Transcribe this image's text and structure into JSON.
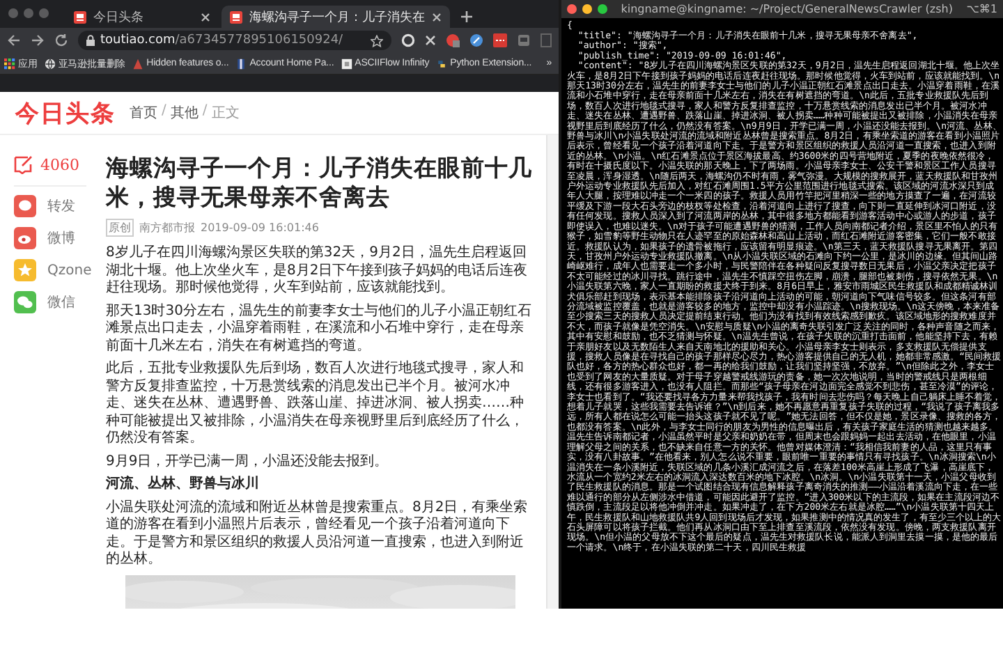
{
  "browser": {
    "tabs": [
      {
        "title": "今日头条",
        "selected": false
      },
      {
        "title": "海螺沟寻子一个月：儿子消失在",
        "selected": true
      }
    ],
    "url_host": "toutiao.com",
    "url_path": "/a6734577895106150924/",
    "bookmarks": [
      "应用",
      "亚马逊批量删除",
      "Hidden features o...",
      "Account Home Pa...",
      "ASCIIFlow Infinity",
      "Python Extension..."
    ],
    "bookmarks_more": "»",
    "page": {
      "logo": "今日头条",
      "breadcrumb": [
        "首页",
        "其他",
        "正文"
      ],
      "breadcrumb_separator": "/",
      "comment_count": "4060",
      "share": [
        {
          "kind": "repost",
          "label": "转发",
          "color": "#ea5a4f"
        },
        {
          "kind": "weibo",
          "label": "微博",
          "color": "#ea5a4f"
        },
        {
          "kind": "qzone",
          "label": "Qzone",
          "color": "#f6bb2e"
        },
        {
          "kind": "wechat",
          "label": "微信",
          "color": "#52bf4f"
        }
      ],
      "article": {
        "title": "海螺沟寻子一个月：儿子消失在眼前十几米，搜寻无果母亲不舍离去",
        "tag": "原创",
        "source": "南方都市报",
        "time": "2019-09-09 16:01:46",
        "blocks": [
          {
            "kind": "paragraph",
            "text": "8岁儿子在四川海螺沟景区失联的第32天，9月2日，温先生启程返回湖北十堰。他上次坐火车，是8月2日下午接到孩子妈妈的电话后连夜赶往现场。那时候他觉得，火车到站前，应该就能找到。"
          },
          {
            "kind": "paragraph",
            "text": "那天13时30分左右，温先生的前妻李女士与他们的儿子小温正朝红石滩景点出口走去，小温穿着雨鞋，在溪流和小石堆中穿行，走在母亲前面十几米左右，消失在有树遮挡的弯道。"
          },
          {
            "kind": "paragraph",
            "text": "此后，五批专业救援队先后到场，数百人次进行地毯式搜寻，家人和警方反复排查监控，十万悬赏线索的消息发出已半个月。被河水冲走、迷失在丛林、遭遇野兽、跌落山崖、掉进冰洞、被人拐卖……种种可能被提出又被排除，小温消失在母亲视野里后到底经历了什么，仍然没有答案。"
          },
          {
            "kind": "paragraph",
            "text": "9月9日，开学已满一周，小温还没能去报到。"
          },
          {
            "kind": "heading",
            "text": "河流、丛林、野兽与冰川"
          },
          {
            "kind": "paragraph",
            "text": "小温失联处河流的流域和附近丛林曾是搜索重点。8月2日，有乘坐索道的游客在看到小温照片后表示，曾经看见一个孩子沿着河道向下走。于是警方和景区组织的救援人员沿河道一直搜索，也进入到附近的丛林。"
          }
        ]
      }
    }
  },
  "terminal": {
    "title": "kingname@kingname: ~/Project/GeneralNewsCrawler (zsh)",
    "shortcut": "⌥⌘1",
    "lines": [
      "{",
      "  \"title\": \"海螺沟寻子一个月：儿子消失在眼前十几米，搜寻无果母亲不舍离去\",",
      "  \"author\": \"搜索\",",
      "  \"publish_time\": \"2019-09-09 16:01:46\",",
      "  \"content\": \"8岁儿子在四川海螺沟景区失联的第32天，9月2日，温先生启程返回湖北十堰。他上次坐火车，是8月2日下午接到孩子妈妈的电话后连夜赶往现场。那时候他觉得，火车到站前，应该就能找到。\\n那天13时30分左右，温先生的前妻李女士与他们的儿子小温正朝红石滩景点出口走去。小温穿着雨鞋，在溪流和小石堆中穿行，走在母亲前面十几米左右，消失在有树遮挡的弯道。\\n此后，五批专业救援队先后到场，数百人次进行地毯式搜寻，家人和警方反复排查监控，十万悬赏线索的消息发出已半个月。被河水冲走、迷失在丛林、遭遇野兽、跌落山崖、掉进冰洞、被人拐卖……种种可能被提出又被排除，小温消失在母亲视野里后到底经历了什么，仍然没有答案。\\n9月9日，开学已满一周，小温还没能去报到。\\n河流、丛林、野兽与冰川\\n小温失联处河流的流域和附近丛林曾是搜索重点。8月2日，有乘坐索道的游客在看到小温照片后表示，曾经看见一个孩子沿着河道向下走。于是警方和景区组织的救援人员沿河道一直搜索，也进入到附近的丛林。\\n小温。\\n红石滩景点位于景区海拔最高、约3600米的四号营地附近，夏季的夜晚依然很冷，有时在十摄氏度以下。小温失联的那天晚上，下了两场雨。小温母亲李女士、公安干警和景区工作人员搜寻至凌晨，浑身湿透。\\n随后两天，海螺沟仍不时有雨，雾气弥漫。大规模的搜救展开，蓝天救援队和甘孜州户外运动专业救援队先后加入，对红石滩周围1.5平方公里范围进行地毯式搜索。该区域的河流水深只到成年人大腿，按理难以冲走一个一米四的孩子。救援人员用竹竿把河里稍深一些的地方摸查了一遍，在河流较平缓及下游一段大石头旁边的枝杈等处检查，沿着河道向上进行了搜查，向下则一直延伸到冰河口附近，没有任何发现。搜救人员深入到了河流两岸的丛林，其中很多地方都能看到游客活动中心或游人的步道，孩子即使误入，也难以迷失。\\n对于孩子可能遭遇野兽的猜测，工作人员向南都记者介绍，景区里不怕人的只有猴子，如雪豹等野生动物只在人迹罕至的原始森林和高山上活动，而红石滩附近游客密集，它们一般不敢接近。救援队认为，如果孩子的遗骨被拖行，应该留有明显痕迹。\\n第三天，蓝天救援队搜寻无果离开。第四天，甘孜州户外运动专业救援队撤离。\\n从小温失联区域的石滩向下约一公里，是冰川的边缘。但其间山路崎岖难行，成年人也需要走一个多小时，与民警陪伴在各种疑问反复搜寻数日无果后，小温父亲决定把孩子不太可能经过的冰川寻找。跳行途中，温先生不慎踩空扭伤左脚，崩溃，腿部也被刺伤，搜寻依然无果。\\n小温失联第六晚，家人一直期盼的救援犬终于到来。8月6日早上，雅安市雨城区民生救援队和成都精诚林训犬俱乐部赶到现场，表示基本能排除孩子沿河道向上活动的可能，朝河道向下气味信号较多。但这条河有部分流域被监控覆盖，也就是游客较多的地方，监控中却没有小温踪迹。\\n搜救现场。\\n这天傍晚，本来准备至少搜索三天的搜救人员决定提前结束行动。他们为没有找到有效线索感到歉疚。该区域地形的搜救难度并不大，而孩子就像是凭空消失。\\n安慰与质疑\\n小温的离奇失联引发广泛关注的同时，各种声音随之而来，其中有安慰和鼓励，也不乏猜测与怀疑。\\n温先生曾说，在孩子失联的沉重打击面前，他能坚持下去，有赖于亲朋好友以及无数陌生人来自天南地北的援助和关心。小温母亲李女士则表示，多支救援队无偿提供支援，搜救人员像是在寻找自己的孩子那样尽心尽力，热心游客提供自己的无人机，她都非常感激。“民间救援队也好，各方的热心群众也好，都一再的给我们鼓励，让我们坚持坚强，不放弃。”\\n但除此之外，李女士也受到了网友的大量质疑。对于母子穿越警戒线游玩的责备，她一次次地说明，当时的警戒线只是两根细线，还有很多游客进入，也没有人阻拦。而那些“孩子母亲在河边面完全感觉不到悲伤，甚至冷漠”的评论，李女士也看到了。“我还要找寻各方力量来帮我找孩子，我有时间去悲伤吗？每天晚上自己躺床上睡不着觉，想着儿子就哭，这些我需要去告诉谁？”\\n到后来，她不再愿意再重复孩子失联的过程，“我说了孩子离我多远，所有人都在说怎么可能一抬头这孩子就不见了呢。”她无法回答，但不仅是她，景区录像、搜救的各方，也都没有答案。\\n此外，与李女士同行的朋友为男性的信息曝出后，有关孩子家庭生活的猜测也越来越多。温先生告诉南都记者，小温虽然平时是父亲和奶奶在带，但周末也会跟妈妈一起出去活动，在他眼里，小温理解父母之间的关系，也不缺来自任意一方的关怀。他曾对媒体澄清：“我相信我前妻的人品，这里只有事实，没有八卦故事。”在他看来，别人怎么说不重要，眼前唯一重要的事情只有寻找孩子。\\n冰洞搜索\\n小温消失在一条小溪附近，失联区域的几条小溪汇成河流之后，在落差100米高崖上形成了飞瀑，高崖底下，水流从一个宽约2米左右的冰洞流入深达数百米的地下冰腔。\\n冰洞。\\n小温失联第十一天，小温父母收到了民生救援队的消息。那是一个试图结合现有信息解释孩子离奇消失的推测——小温沿着溪流向下走，在一些难以通行的部分从左侧涉水中借道，可能因此避开了监控。“进入300米以下的主流段，如果在主流段河边不慎跌倒，主流段足以将他冲倒并冲走。如果冲走了，在下方200米左右就是冰腔……”\\n小温失联第十四天上午，民生救援队和山地救援队共9人回到现场后才发现，如果推测中的情况真的发生了，有至少三个以上的大石头屏障可以将孩子拦截。他们再从冰洞口由下至上排查至溪流段，依然没有发现。傍晚，两支救援队离开现场。\\n但小温的父母放不下这个最后的疑点，温先生对救援队长说，能派人到洞里去摸一摸，是他的最后一个请求。\\n终于，在小温失联的第二十天，四川民生救援"
    ]
  }
}
